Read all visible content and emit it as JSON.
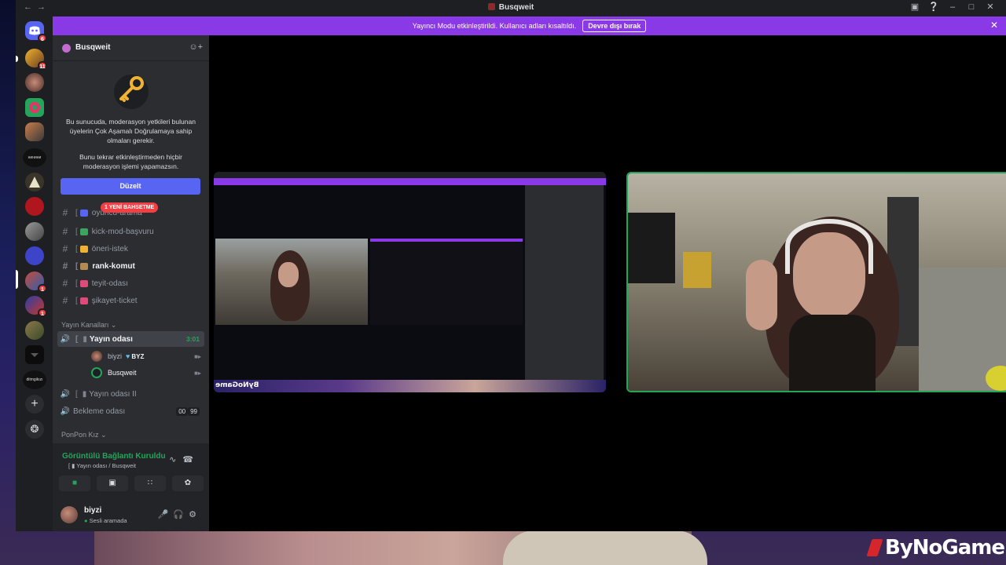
{
  "window": {
    "title": "Busqweit"
  },
  "notice": {
    "text": "Yayıncı Modu etkinleştirildi. Kullanıcı adları kısaltıldı.",
    "button": "Devre dışı bırak"
  },
  "rail": {
    "badges": [
      "6",
      "11",
      "1",
      "1"
    ],
    "labels": [
      "нинини",
      "ditmgikızı"
    ]
  },
  "server": {
    "name": "Busqweit"
  },
  "mfa": {
    "text1": "Bu sunucuda, moderasyon yetkileri bulunan üyelerin Çok Aşamalı Doğrulamaya sahip olmaları gerekir.",
    "text2": "Bunu tekrar etkinleştirmeden hiçbir moderasyon işlemi yapamazsın.",
    "button": "Düzelt"
  },
  "channels": [
    {
      "label": "oyuncu-arama",
      "mention": "1 YENİ BAHSETME",
      "color": "#5865f2"
    },
    {
      "label": "kick-mod-başvuru",
      "color": "#3ba55d"
    },
    {
      "label": "öneri-istek",
      "color": "#f0b232"
    },
    {
      "label": "rank-komut",
      "color": "#b48a52"
    },
    {
      "label": "teyit-odası",
      "color": "#e04a7a"
    },
    {
      "label": "şikayet-ticket",
      "color": "#e04a7a"
    }
  ],
  "voice_category": "Yayın Kanalları",
  "voice_channels": [
    {
      "label": "Yayın odası",
      "timer": "3:01"
    },
    {
      "label": "Yayın odası II"
    },
    {
      "label": "Bekleme odası",
      "count_a": "00",
      "count_b": "99"
    }
  ],
  "members": [
    {
      "name": "biyzi",
      "tag": "BYZ"
    },
    {
      "name": "Busqweit"
    }
  ],
  "category2": "PonPon Kız",
  "voice_panel": {
    "title": "Görüntülü Bağlantı Kuruldu",
    "subtitle": "Yayın odası / Busqweit"
  },
  "user": {
    "name": "biyzi",
    "status": "Sesli aramada"
  },
  "watermark": "ByNoGame",
  "colors": {
    "accent": "#8a39e6",
    "green": "#23a55a",
    "blurple": "#5865f2",
    "red": "#f23f43"
  }
}
